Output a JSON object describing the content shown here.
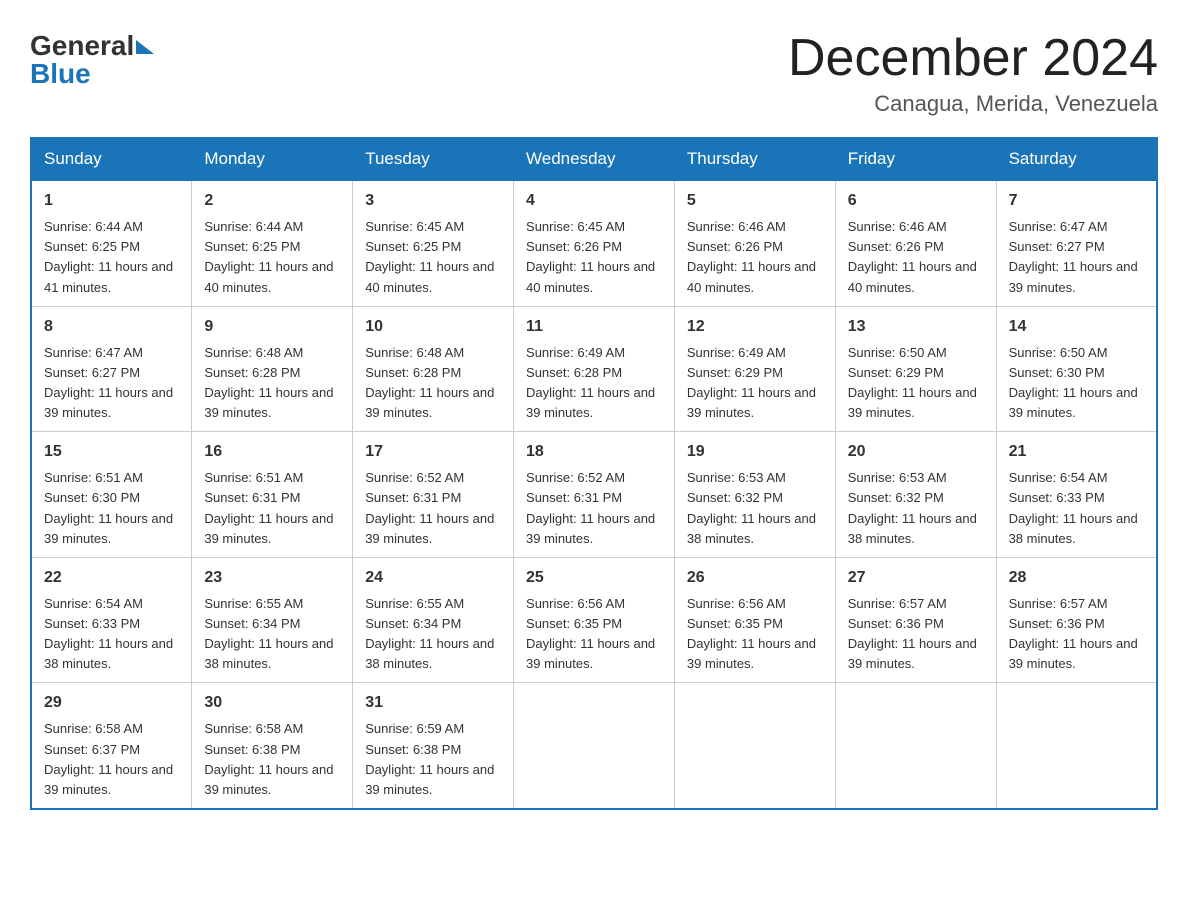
{
  "header": {
    "logo_general": "General",
    "logo_blue": "Blue",
    "title": "December 2024",
    "subtitle": "Canagua, Merida, Venezuela"
  },
  "days_of_week": [
    "Sunday",
    "Monday",
    "Tuesday",
    "Wednesday",
    "Thursday",
    "Friday",
    "Saturday"
  ],
  "weeks": [
    [
      {
        "day": "1",
        "sunrise": "6:44 AM",
        "sunset": "6:25 PM",
        "daylight": "11 hours and 41 minutes."
      },
      {
        "day": "2",
        "sunrise": "6:44 AM",
        "sunset": "6:25 PM",
        "daylight": "11 hours and 40 minutes."
      },
      {
        "day": "3",
        "sunrise": "6:45 AM",
        "sunset": "6:25 PM",
        "daylight": "11 hours and 40 minutes."
      },
      {
        "day": "4",
        "sunrise": "6:45 AM",
        "sunset": "6:26 PM",
        "daylight": "11 hours and 40 minutes."
      },
      {
        "day": "5",
        "sunrise": "6:46 AM",
        "sunset": "6:26 PM",
        "daylight": "11 hours and 40 minutes."
      },
      {
        "day": "6",
        "sunrise": "6:46 AM",
        "sunset": "6:26 PM",
        "daylight": "11 hours and 40 minutes."
      },
      {
        "day": "7",
        "sunrise": "6:47 AM",
        "sunset": "6:27 PM",
        "daylight": "11 hours and 39 minutes."
      }
    ],
    [
      {
        "day": "8",
        "sunrise": "6:47 AM",
        "sunset": "6:27 PM",
        "daylight": "11 hours and 39 minutes."
      },
      {
        "day": "9",
        "sunrise": "6:48 AM",
        "sunset": "6:28 PM",
        "daylight": "11 hours and 39 minutes."
      },
      {
        "day": "10",
        "sunrise": "6:48 AM",
        "sunset": "6:28 PM",
        "daylight": "11 hours and 39 minutes."
      },
      {
        "day": "11",
        "sunrise": "6:49 AM",
        "sunset": "6:28 PM",
        "daylight": "11 hours and 39 minutes."
      },
      {
        "day": "12",
        "sunrise": "6:49 AM",
        "sunset": "6:29 PM",
        "daylight": "11 hours and 39 minutes."
      },
      {
        "day": "13",
        "sunrise": "6:50 AM",
        "sunset": "6:29 PM",
        "daylight": "11 hours and 39 minutes."
      },
      {
        "day": "14",
        "sunrise": "6:50 AM",
        "sunset": "6:30 PM",
        "daylight": "11 hours and 39 minutes."
      }
    ],
    [
      {
        "day": "15",
        "sunrise": "6:51 AM",
        "sunset": "6:30 PM",
        "daylight": "11 hours and 39 minutes."
      },
      {
        "day": "16",
        "sunrise": "6:51 AM",
        "sunset": "6:31 PM",
        "daylight": "11 hours and 39 minutes."
      },
      {
        "day": "17",
        "sunrise": "6:52 AM",
        "sunset": "6:31 PM",
        "daylight": "11 hours and 39 minutes."
      },
      {
        "day": "18",
        "sunrise": "6:52 AM",
        "sunset": "6:31 PM",
        "daylight": "11 hours and 39 minutes."
      },
      {
        "day": "19",
        "sunrise": "6:53 AM",
        "sunset": "6:32 PM",
        "daylight": "11 hours and 38 minutes."
      },
      {
        "day": "20",
        "sunrise": "6:53 AM",
        "sunset": "6:32 PM",
        "daylight": "11 hours and 38 minutes."
      },
      {
        "day": "21",
        "sunrise": "6:54 AM",
        "sunset": "6:33 PM",
        "daylight": "11 hours and 38 minutes."
      }
    ],
    [
      {
        "day": "22",
        "sunrise": "6:54 AM",
        "sunset": "6:33 PM",
        "daylight": "11 hours and 38 minutes."
      },
      {
        "day": "23",
        "sunrise": "6:55 AM",
        "sunset": "6:34 PM",
        "daylight": "11 hours and 38 minutes."
      },
      {
        "day": "24",
        "sunrise": "6:55 AM",
        "sunset": "6:34 PM",
        "daylight": "11 hours and 38 minutes."
      },
      {
        "day": "25",
        "sunrise": "6:56 AM",
        "sunset": "6:35 PM",
        "daylight": "11 hours and 39 minutes."
      },
      {
        "day": "26",
        "sunrise": "6:56 AM",
        "sunset": "6:35 PM",
        "daylight": "11 hours and 39 minutes."
      },
      {
        "day": "27",
        "sunrise": "6:57 AM",
        "sunset": "6:36 PM",
        "daylight": "11 hours and 39 minutes."
      },
      {
        "day": "28",
        "sunrise": "6:57 AM",
        "sunset": "6:36 PM",
        "daylight": "11 hours and 39 minutes."
      }
    ],
    [
      {
        "day": "29",
        "sunrise": "6:58 AM",
        "sunset": "6:37 PM",
        "daylight": "11 hours and 39 minutes."
      },
      {
        "day": "30",
        "sunrise": "6:58 AM",
        "sunset": "6:38 PM",
        "daylight": "11 hours and 39 minutes."
      },
      {
        "day": "31",
        "sunrise": "6:59 AM",
        "sunset": "6:38 PM",
        "daylight": "11 hours and 39 minutes."
      },
      null,
      null,
      null,
      null
    ]
  ],
  "labels": {
    "sunrise": "Sunrise:",
    "sunset": "Sunset:",
    "daylight": "Daylight:"
  }
}
